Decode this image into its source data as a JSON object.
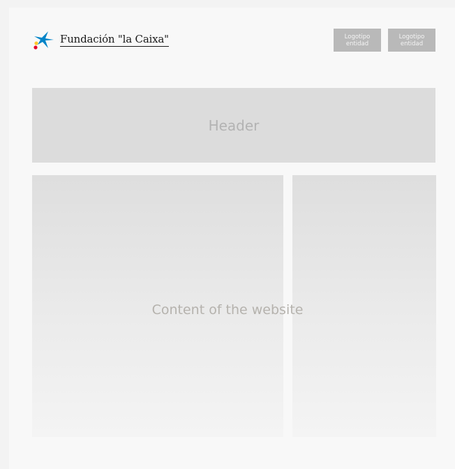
{
  "brand": {
    "name": "Fundación \"la Caixa\"",
    "mark_icon": "la-caixa-star-icon",
    "colors": {
      "star": "#0084c8",
      "dot_red": "#e4002b",
      "dot_yellow": "#ffc72c"
    }
  },
  "entity_logos": [
    {
      "label": "Logotipo entidad"
    },
    {
      "label": "Logotipo entidad"
    }
  ],
  "header": {
    "label": "Header"
  },
  "content": {
    "label": "Content of the website"
  }
}
